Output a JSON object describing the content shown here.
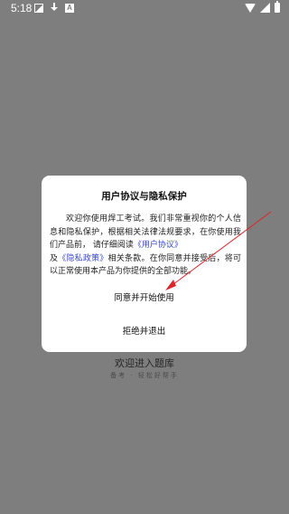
{
  "status_bar": {
    "time": "5:18",
    "icons_left": [
      "image-icon",
      "download-icon",
      "a-icon"
    ],
    "icons_right": [
      "wifi-icon",
      "signal-icon",
      "battery-icon"
    ]
  },
  "background": {
    "welcome_text": "欢迎进入题库",
    "sub_text": "备考 · 轻松好帮手"
  },
  "dialog": {
    "title": "用户协议与隐私保护",
    "body_part1": "欢迎你使用焊工考试。我们非常重视你的个人信息和隐私保护，根据相关法律法规要求，在你使用我们产品前， 请仔细阅读",
    "user_agreement_link": "《用户协议》",
    "body_part2": "及",
    "privacy_policy_link": "《隐私政策》",
    "body_part3": "相关条款。在你同意并接受后，将可以正常使用本产品为你提供的全部功能。",
    "agree_label": "同意并开始使用",
    "reject_label": "拒绝并退出"
  },
  "colors": {
    "overlay": "#7e7e7e",
    "link": "#3948c7",
    "annotation": "#e0242b"
  }
}
